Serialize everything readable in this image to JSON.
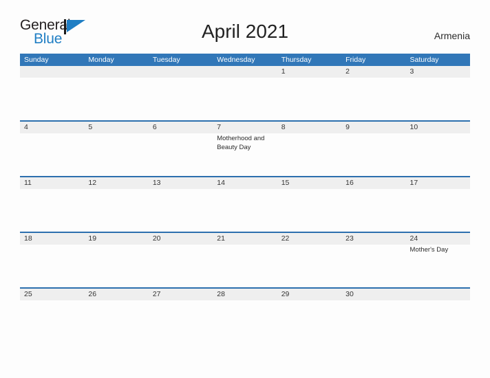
{
  "brand": {
    "name_part1": "General",
    "name_part2": "Blue",
    "flag_icon": "flag-icon",
    "color_dark": "#231f20",
    "color_blue": "#1f7ec4"
  },
  "header": {
    "title": "April 2021",
    "country": "Armenia"
  },
  "colors": {
    "header_blue": "#3177b8",
    "row_divider_blue": "#2c6fae",
    "date_band_gray": "#efefef",
    "page_background": "#fdfdfd"
  },
  "weekdays": [
    "Sunday",
    "Monday",
    "Tuesday",
    "Wednesday",
    "Thursday",
    "Friday",
    "Saturday"
  ],
  "weeks": [
    {
      "days": [
        {
          "number": "",
          "events": []
        },
        {
          "number": "",
          "events": []
        },
        {
          "number": "",
          "events": []
        },
        {
          "number": "",
          "events": []
        },
        {
          "number": "1",
          "events": []
        },
        {
          "number": "2",
          "events": []
        },
        {
          "number": "3",
          "events": []
        }
      ]
    },
    {
      "days": [
        {
          "number": "4",
          "events": []
        },
        {
          "number": "5",
          "events": []
        },
        {
          "number": "6",
          "events": []
        },
        {
          "number": "7",
          "events": [
            "Motherhood and Beauty Day"
          ]
        },
        {
          "number": "8",
          "events": []
        },
        {
          "number": "9",
          "events": []
        },
        {
          "number": "10",
          "events": []
        }
      ]
    },
    {
      "days": [
        {
          "number": "11",
          "events": []
        },
        {
          "number": "12",
          "events": []
        },
        {
          "number": "13",
          "events": []
        },
        {
          "number": "14",
          "events": []
        },
        {
          "number": "15",
          "events": []
        },
        {
          "number": "16",
          "events": []
        },
        {
          "number": "17",
          "events": []
        }
      ]
    },
    {
      "days": [
        {
          "number": "18",
          "events": []
        },
        {
          "number": "19",
          "events": []
        },
        {
          "number": "20",
          "events": []
        },
        {
          "number": "21",
          "events": []
        },
        {
          "number": "22",
          "events": []
        },
        {
          "number": "23",
          "events": []
        },
        {
          "number": "24",
          "events": [
            "Mother's Day"
          ]
        }
      ]
    },
    {
      "days": [
        {
          "number": "25",
          "events": []
        },
        {
          "number": "26",
          "events": []
        },
        {
          "number": "27",
          "events": []
        },
        {
          "number": "28",
          "events": []
        },
        {
          "number": "29",
          "events": []
        },
        {
          "number": "30",
          "events": []
        },
        {
          "number": "",
          "events": []
        }
      ]
    }
  ]
}
